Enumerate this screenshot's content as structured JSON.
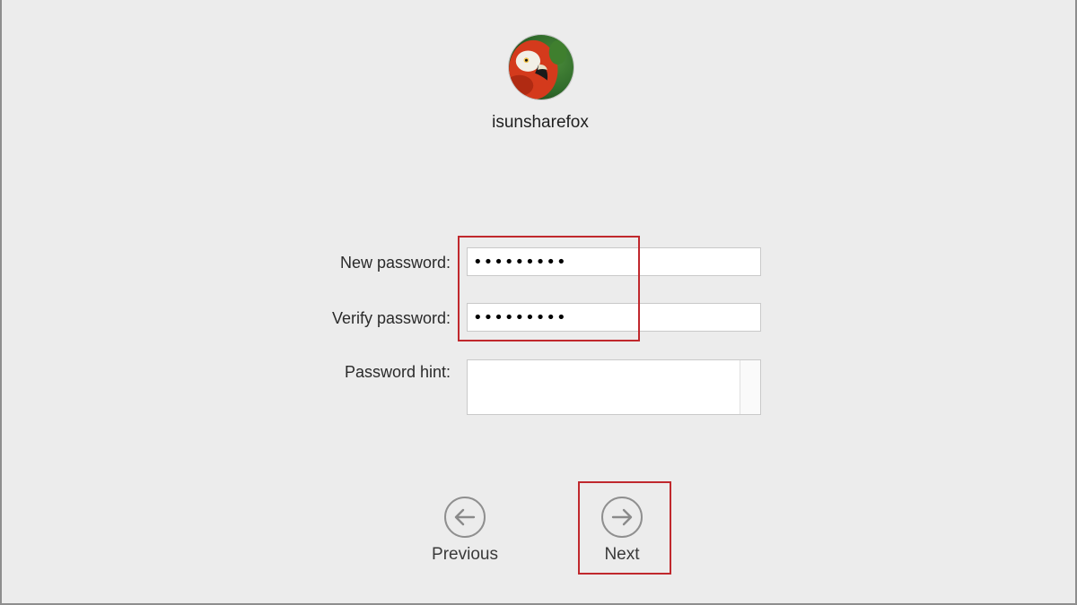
{
  "user": {
    "name": "isunsharefox",
    "avatar_icon": "parrot-avatar"
  },
  "form": {
    "new_password": {
      "label": "New password:",
      "value": "secret123"
    },
    "verify_password": {
      "label": "Verify password:",
      "value": "secret123"
    },
    "password_hint": {
      "label": "Password hint:",
      "value": ""
    }
  },
  "navigation": {
    "previous": {
      "label": "Previous",
      "icon": "arrow-left-icon"
    },
    "next": {
      "label": "Next",
      "icon": "arrow-right-icon"
    }
  },
  "colors": {
    "background": "#ececec",
    "highlight": "#c0282d"
  }
}
